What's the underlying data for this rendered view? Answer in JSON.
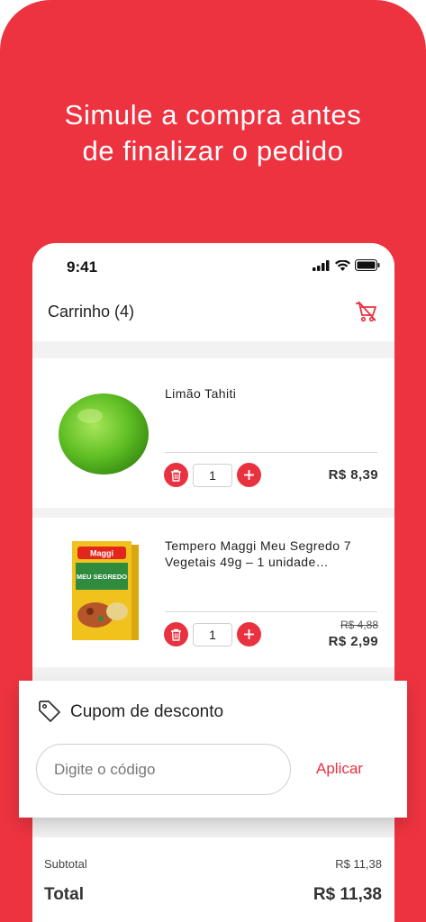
{
  "colors": {
    "brand_red": "#ee3340",
    "button_red": "#e8323f"
  },
  "headline": {
    "line1": "Simule a compra antes",
    "line2": "de finalizar o pedido"
  },
  "status_bar": {
    "time": "9:41",
    "icons": [
      "signal-icon",
      "wifi-icon",
      "battery-icon"
    ]
  },
  "cart": {
    "title": "Carrinho (4)",
    "clear_icon": "cart-clear-icon",
    "items": [
      {
        "name": "Limão Tahiti",
        "quantity": "1",
        "price": "R$ 8,39",
        "image": "lime-image"
      },
      {
        "name": "Tempero Maggi Meu Segredo 7 Vegetais 49g – 1 unidade…",
        "quantity": "1",
        "old_price": "R$ 4,88",
        "price": "R$ 2,99",
        "image": "seasoning-box-image",
        "package_brand": "Maggi",
        "package_text": "MEU SEGREDO"
      }
    ]
  },
  "coupon": {
    "title": "Cupom de desconto",
    "input_placeholder": "Digite o código",
    "apply_label": "Aplicar",
    "icon": "tag-icon"
  },
  "summary": {
    "subtotal_label": "Subtotal",
    "subtotal_value": "R$ 11,38",
    "total_label": "Total",
    "total_value": "R$ 11,38"
  }
}
